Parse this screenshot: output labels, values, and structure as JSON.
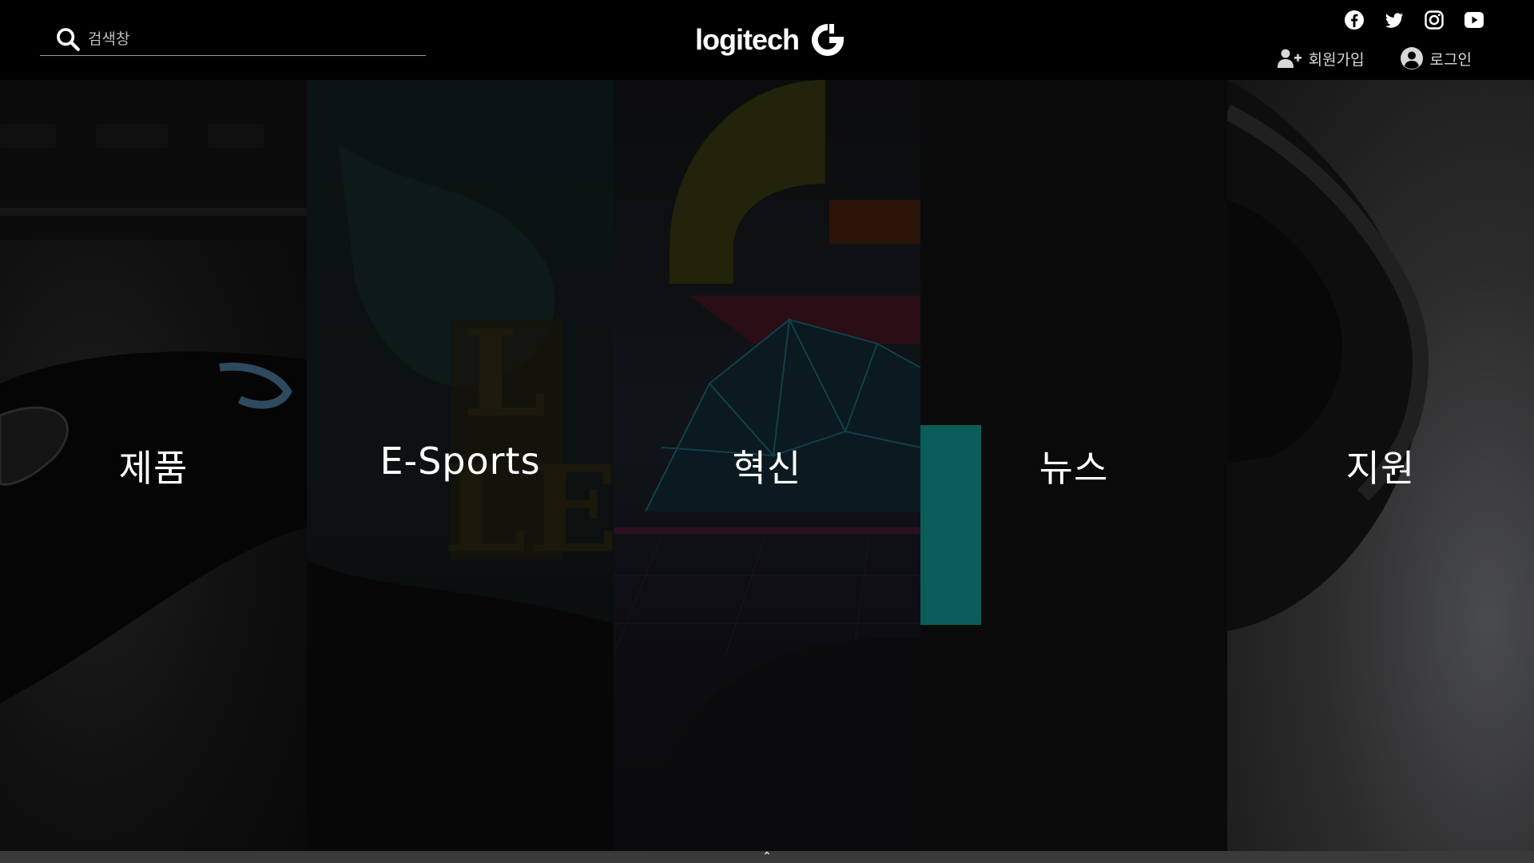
{
  "search": {
    "placeholder": "검색창"
  },
  "logo": {
    "text": "logitech"
  },
  "social": {
    "icons": [
      "facebook-icon",
      "twitter-icon",
      "instagram-icon",
      "youtube-icon"
    ]
  },
  "account": {
    "signup_label": "회원가입",
    "login_label": "로그인"
  },
  "panels": [
    {
      "label": "제품"
    },
    {
      "label": "E-Sports"
    },
    {
      "label": "혁신"
    },
    {
      "label": "뉴스"
    },
    {
      "label": "지원"
    }
  ],
  "colors": {
    "accent_teal": "#0a5d59",
    "background": "#000000",
    "footer": "#3a3a3a"
  }
}
